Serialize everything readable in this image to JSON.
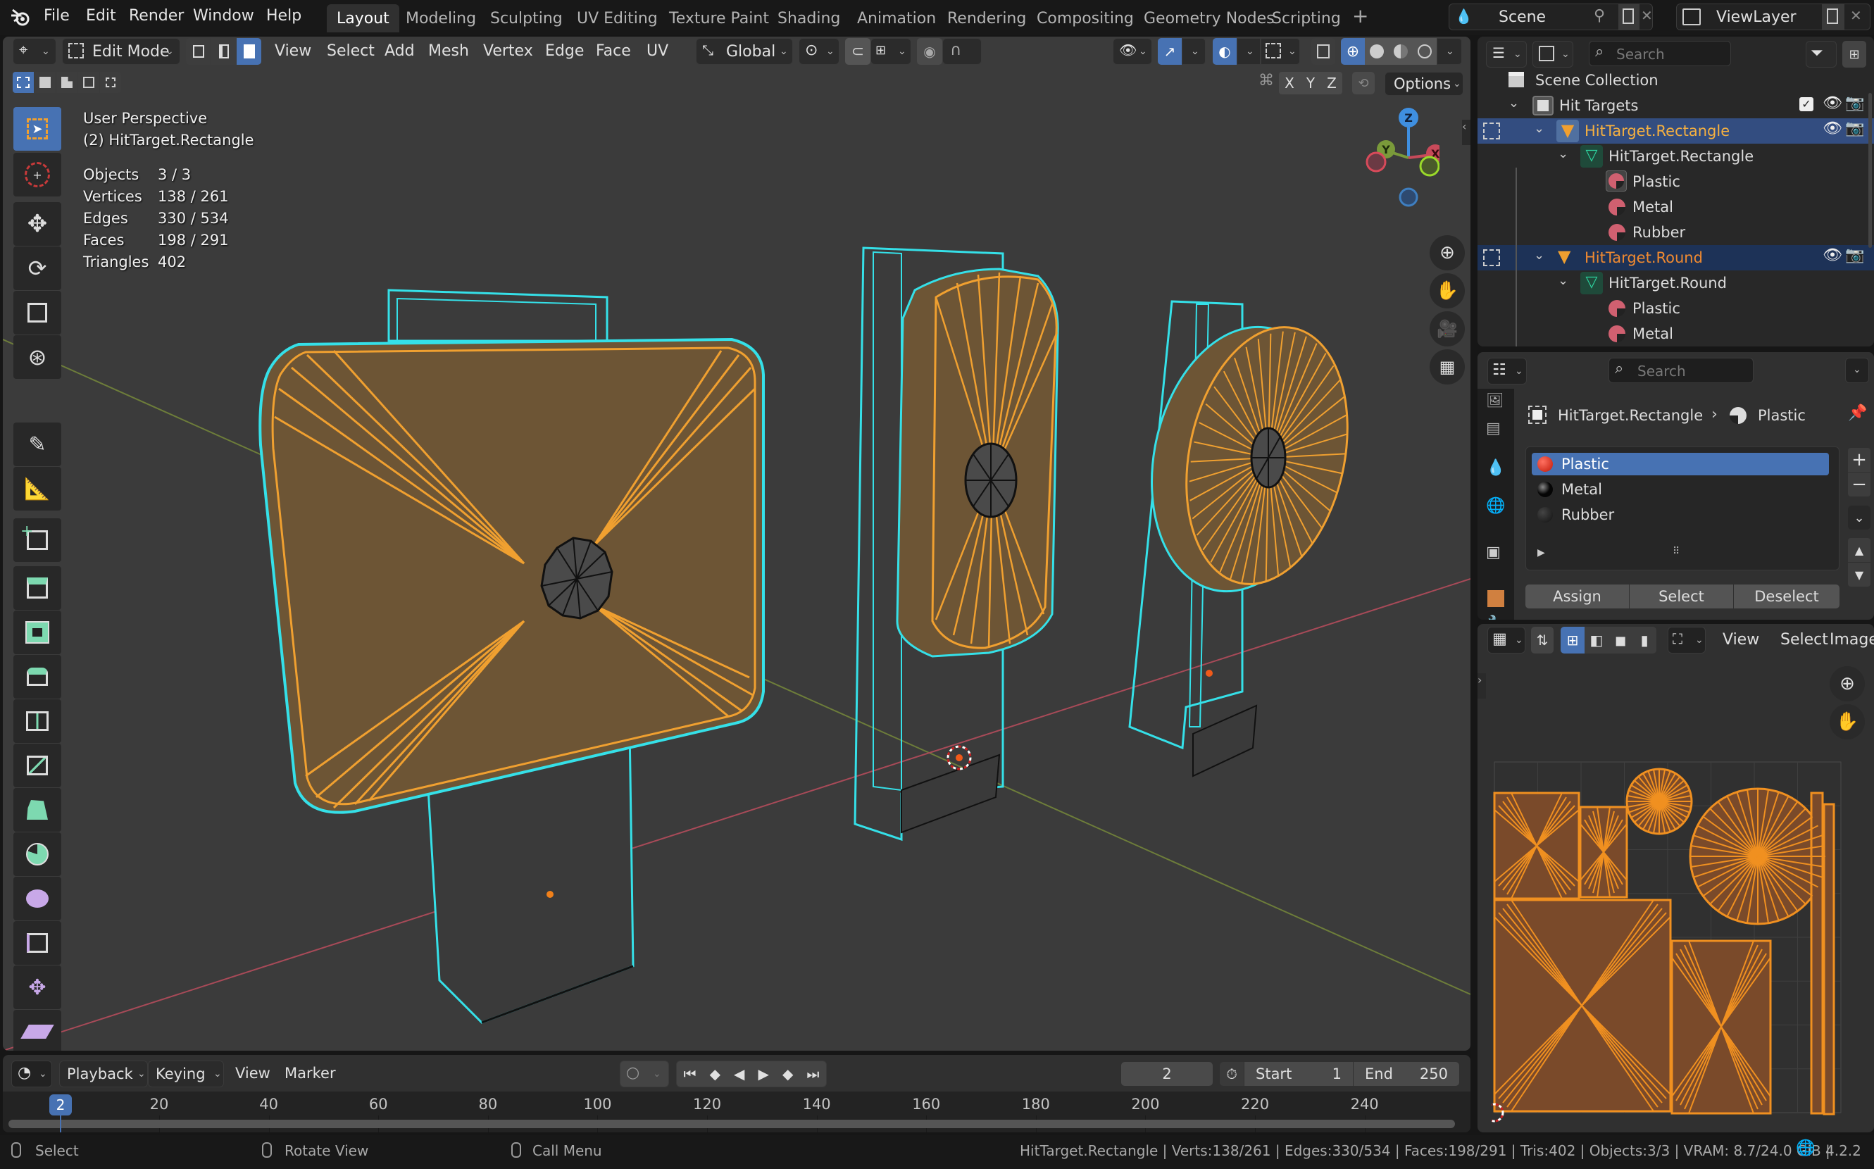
{
  "app": {
    "menus": [
      "File",
      "Edit",
      "Render",
      "Window",
      "Help"
    ],
    "workspaces": [
      "Layout",
      "Modeling",
      "Sculpting",
      "UV Editing",
      "Texture Paint",
      "Shading",
      "Animation",
      "Rendering",
      "Compositing",
      "Geometry Nodes",
      "Scripting"
    ],
    "active_workspace": "Layout",
    "add_workspace": "+",
    "scene": "Scene",
    "view_layer": "ViewLayer"
  },
  "viewport_header": {
    "mode": "Edit Mode",
    "menus": [
      "View",
      "Select",
      "Add",
      "Mesh",
      "Vertex",
      "Edge",
      "Face",
      "UV"
    ],
    "transform_orientation": "Global",
    "select_mode_active": "face",
    "mirror_axes": [
      "X",
      "Y",
      "Z"
    ],
    "options_label": "Options",
    "shading_active": "wireframe"
  },
  "viewport": {
    "view_name": "User Perspective",
    "object_label": "(2) HitTarget.Rectangle",
    "stats": [
      {
        "label": "Objects",
        "value": "3 / 3"
      },
      {
        "label": "Vertices",
        "value": "138 / 261"
      },
      {
        "label": "Edges",
        "value": "330 / 534"
      },
      {
        "label": "Faces",
        "value": "198 / 291"
      },
      {
        "label": "Triangles",
        "value": "402"
      }
    ],
    "gizmo_axes": [
      "Z",
      "Y",
      "X"
    ],
    "colors": {
      "selected_face": "#f0a030",
      "object_outline": "#35e0e8",
      "x_axis": "#c84a5a",
      "y_axis": "#7a9a3a",
      "z_axis": "#3f8fe0"
    }
  },
  "tools": [
    "select-box",
    "cursor",
    "move",
    "rotate",
    "scale",
    "transform",
    "annotate",
    "measure",
    "add-cube",
    "extrude",
    "inset",
    "bevel",
    "loop-cut",
    "knife",
    "poly-build",
    "spin",
    "smooth",
    "edge-slide",
    "shrink-fatten",
    "shear",
    "rip"
  ],
  "outliner": {
    "search_placeholder": "Search",
    "rows": [
      {
        "label": "Scene Collection",
        "type": "scene-collection",
        "indent": 0
      },
      {
        "label": "Hit Targets",
        "type": "collection",
        "indent": 1
      },
      {
        "label": "HitTarget.Rectangle",
        "type": "object",
        "indent": 2,
        "state": "active"
      },
      {
        "label": "HitTarget.Rectangle",
        "type": "mesh",
        "indent": 3
      },
      {
        "label": "Plastic",
        "type": "material",
        "indent": 4
      },
      {
        "label": "Metal",
        "type": "material",
        "indent": 4
      },
      {
        "label": "Rubber",
        "type": "material",
        "indent": 4
      },
      {
        "label": "HitTarget.Round",
        "type": "object",
        "indent": 2,
        "state": "selected"
      },
      {
        "label": "HitTarget.Round",
        "type": "mesh",
        "indent": 3
      },
      {
        "label": "Plastic",
        "type": "material",
        "indent": 4
      },
      {
        "label": "Metal",
        "type": "material",
        "indent": 4
      }
    ]
  },
  "properties": {
    "search_placeholder": "Search",
    "breadcrumb_object": "HitTarget.Rectangle",
    "breadcrumb_material": "Plastic",
    "material_slots": [
      {
        "label": "Plastic",
        "color": "#e03020",
        "active": true
      },
      {
        "label": "Metal",
        "color": "#111111",
        "active": false
      },
      {
        "label": "Rubber",
        "color": "#2a2a2a",
        "active": false
      }
    ],
    "buttons": {
      "assign": "Assign",
      "select": "Select",
      "deselect": "Deselect"
    }
  },
  "uv_editor": {
    "menus": [
      "View",
      "Select",
      "Image"
    ]
  },
  "timeline": {
    "menus": {
      "playback": "Playback",
      "keying": "Keying",
      "view": "View",
      "marker": "Marker"
    },
    "current_frame": "2",
    "start_label": "Start",
    "start": "1",
    "end_label": "End",
    "end": "250",
    "ticks": [
      "20",
      "40",
      "60",
      "80",
      "100",
      "120",
      "140",
      "160",
      "180",
      "200",
      "220",
      "240"
    ]
  },
  "statusbar": {
    "hints": [
      "Select",
      "Rotate View",
      "Call Menu"
    ],
    "info": "HitTarget.Rectangle | Verts:138/261 | Edges:330/534 | Faces:198/291 | Tris:402 | Objects:3/3 | VRAM: 8.7/24.0 GiB |",
    "version": "4.2.2"
  }
}
